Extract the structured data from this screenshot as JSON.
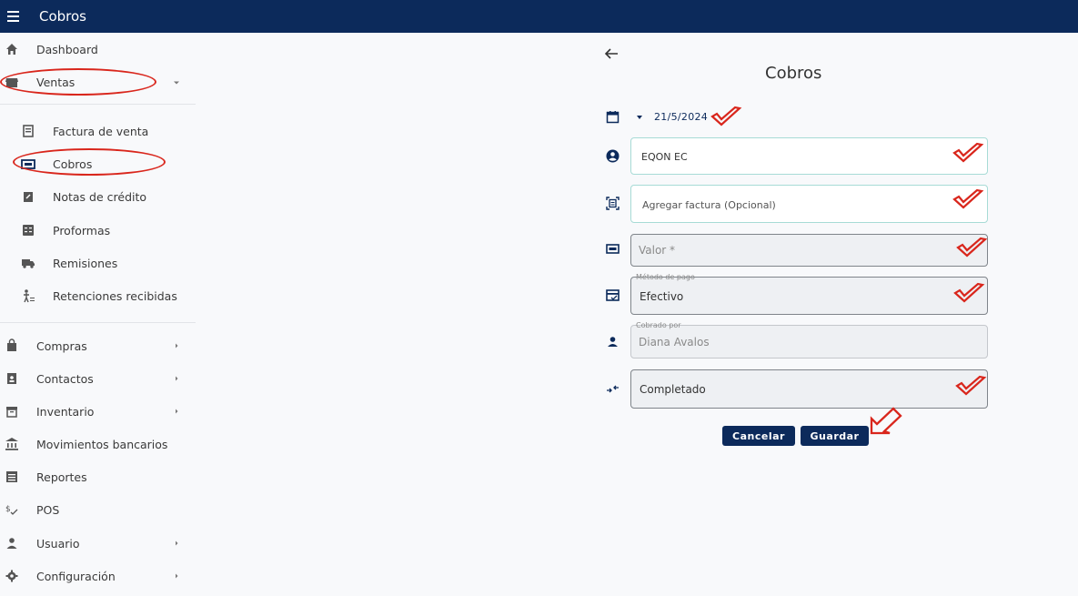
{
  "appbar": {
    "title": "Cobros"
  },
  "sidebar": {
    "dashboard": "Dashboard",
    "ventas": "Ventas",
    "sub": {
      "factura": "Factura de venta",
      "cobros": "Cobros",
      "notas": "Notas de crédito",
      "proformas": "Proformas",
      "remisiones": "Remisiones",
      "retenciones": "Retenciones recibidas"
    },
    "compras": "Compras",
    "contactos": "Contactos",
    "inventario": "Inventario",
    "movimientos": "Movimientos bancarios",
    "reportes": "Reportes",
    "pos": "POS",
    "usuario": "Usuario",
    "configuracion": "Configuración"
  },
  "form": {
    "title": "Cobros",
    "date": "21/5/2024",
    "client": "EQON EC",
    "invoice_placeholder": "Agregar factura (Opcional)",
    "valor_placeholder": "Valor *",
    "metodo_label": "Método de pago",
    "metodo_value": "Efectivo",
    "cobrado_label": "Cobrado por",
    "cobrado_value": "Diana Avalos",
    "estado_value": "Completado",
    "cancel": "Cancelar",
    "save": "Guardar"
  },
  "colors": {
    "primary": "#0c2a5b",
    "annotation": "#d9261c",
    "outline": "#a7dbd6"
  }
}
